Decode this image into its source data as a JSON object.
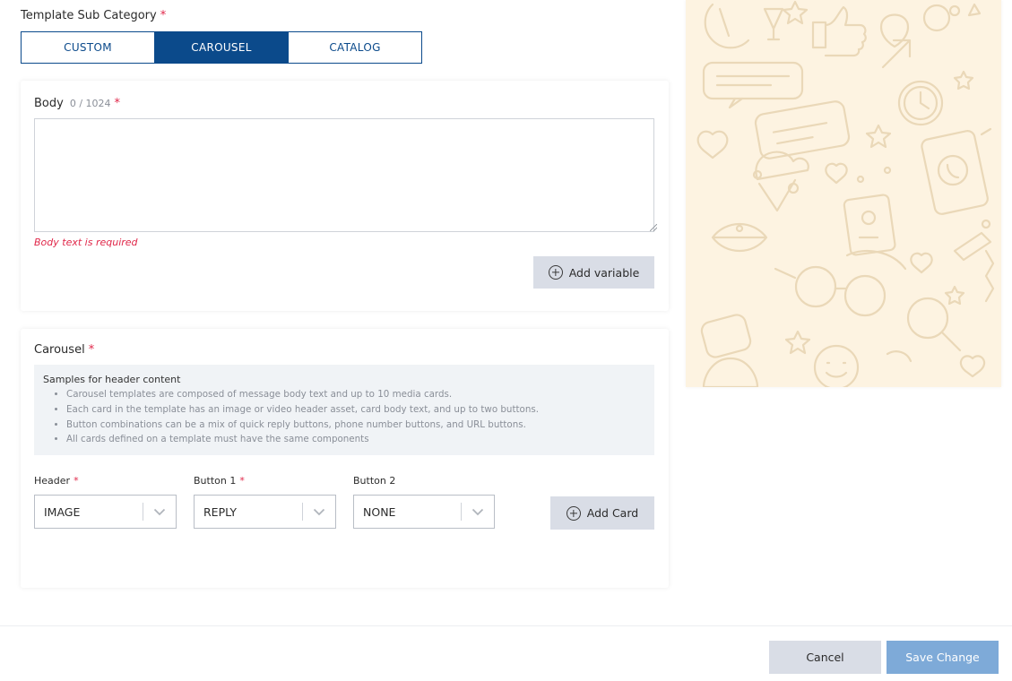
{
  "sub_category": {
    "label": "Template Sub Category",
    "required_mark": "*",
    "options": [
      "CUSTOM",
      "CAROUSEL",
      "CATALOG"
    ],
    "selected": "CAROUSEL"
  },
  "body": {
    "label": "Body",
    "counter": "0 / 1024",
    "required_mark": "*",
    "value": "",
    "error": "Body text is required",
    "add_variable_label": "Add variable"
  },
  "carousel": {
    "label": "Carousel",
    "required_mark": "*",
    "samples_title": "Samples for header content",
    "samples": [
      "Carousel templates are composed of message body text and up to 10 media cards.",
      "Each card in the template has an image or video header asset, card body text, and up to two buttons.",
      "Button combinations can be a mix of quick reply buttons, phone number buttons, and URL buttons.",
      "All cards defined on a template must have the same components"
    ],
    "header": {
      "label": "Header",
      "required_mark": "*",
      "value": "IMAGE"
    },
    "button1": {
      "label": "Button 1",
      "required_mark": "*",
      "value": "REPLY"
    },
    "button2": {
      "label": "Button 2",
      "value": "NONE"
    },
    "add_card_label": "Add Card"
  },
  "footer": {
    "cancel_label": "Cancel",
    "save_label": "Save Change"
  },
  "colors": {
    "primary": "#0b4a8b",
    "required": "#e0284a",
    "save_button": "#7eaad8",
    "secondary_button": "#d9dde6",
    "preview_background": "#fdf3e1",
    "preview_doodle": "#ead8b8"
  }
}
